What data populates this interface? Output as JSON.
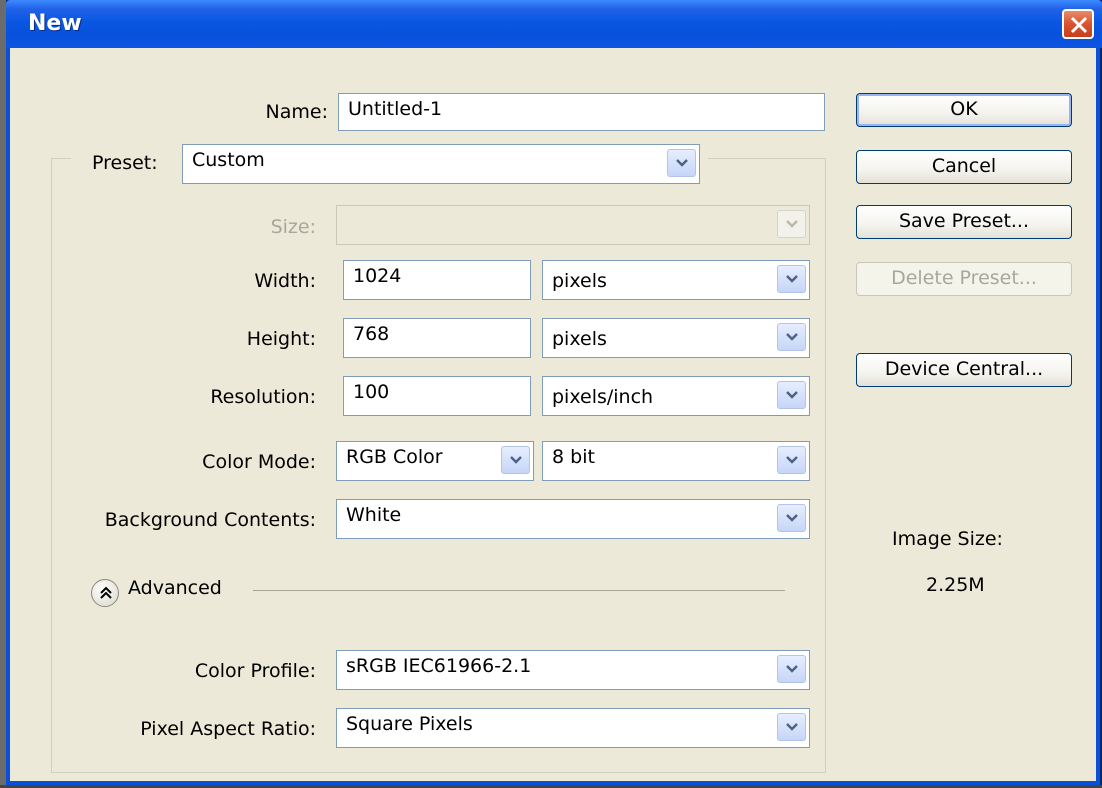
{
  "window": {
    "title": "New"
  },
  "form": {
    "name_label": "Name:",
    "name_value": "Untitled-1",
    "preset_label": "Preset:",
    "preset_value": "Custom",
    "size_label": "Size:",
    "size_value": "",
    "width_label": "Width:",
    "width_value": "1024",
    "width_unit": "pixels",
    "height_label": "Height:",
    "height_value": "768",
    "height_unit": "pixels",
    "resolution_label": "Resolution:",
    "resolution_value": "100",
    "resolution_unit": "pixels/inch",
    "color_mode_label": "Color Mode:",
    "color_mode_value": "RGB Color",
    "bit_depth_value": "8 bit",
    "background_label": "Background Contents:",
    "background_value": "White",
    "advanced_label": "Advanced",
    "color_profile_label": "Color Profile:",
    "color_profile_value": "sRGB IEC61966-2.1",
    "pixel_aspect_label": "Pixel Aspect Ratio:",
    "pixel_aspect_value": "Square Pixels"
  },
  "buttons": {
    "ok": "OK",
    "cancel": "Cancel",
    "save_preset": "Save Preset...",
    "delete_preset": "Delete Preset...",
    "device_central": "Device Central..."
  },
  "info": {
    "image_size_label": "Image Size:",
    "image_size_value": "2.25M"
  },
  "colors": {
    "titlebar": "#0a57e3",
    "dialog_bg": "#ece9d8",
    "close_button": "#d8532e",
    "field_border": "#7f9db9"
  }
}
